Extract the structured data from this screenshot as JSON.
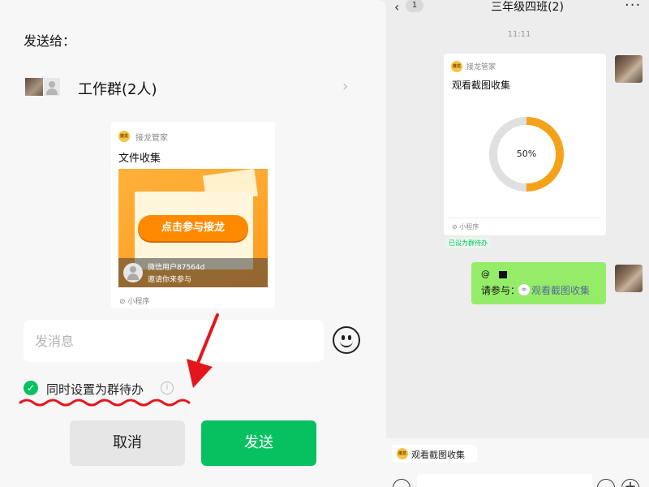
{
  "chat": {
    "back_icon": "chevron-left-icon",
    "unread_badge": "1",
    "title": "三年级四班(2)",
    "more_icon": "more-dots-icon",
    "time": "11:11",
    "card": {
      "app_logo_text": "接龙",
      "app_name": "接龙管家",
      "title": "观看截图收集",
      "progress_percent": 50,
      "progress_label": "50%",
      "footer": "小程序",
      "todo_tag": "已设为群待办",
      "ring_color": "#f5a21b",
      "ring_track_color": "#e0e0e0"
    },
    "bubble": {
      "at": "@",
      "request_label": "请参与：",
      "link_text": "观看截图收集",
      "color": "#95ec69"
    },
    "todo_chip": {
      "logo_text": "接龙",
      "label": "观看截图收集"
    },
    "input_bar": {
      "voice_icon": "voice-icon",
      "emoji_icon": "emoji-icon",
      "plus_icon": "plus-icon"
    }
  },
  "sheet": {
    "title": "发送给：",
    "recipient": {
      "name": "工作群(2人)",
      "chevron_icon": "chevron-right-icon"
    },
    "preview": {
      "logo_text": "接龙",
      "app_name": "接龙管家",
      "title": "文件收集",
      "cta": "点击参与接龙",
      "user_name": "微信用户87564d",
      "invite_text": "邀请你来参与",
      "footer": "小程序",
      "banner_color": "#ff9f26"
    },
    "message_input": {
      "placeholder": "发消息"
    },
    "set_todo": {
      "checked": true,
      "label": "同时设置为群待办",
      "info_icon": "info-icon"
    },
    "buttons": {
      "cancel": "取消",
      "send": "发送"
    },
    "accent_color": "#07c160"
  }
}
